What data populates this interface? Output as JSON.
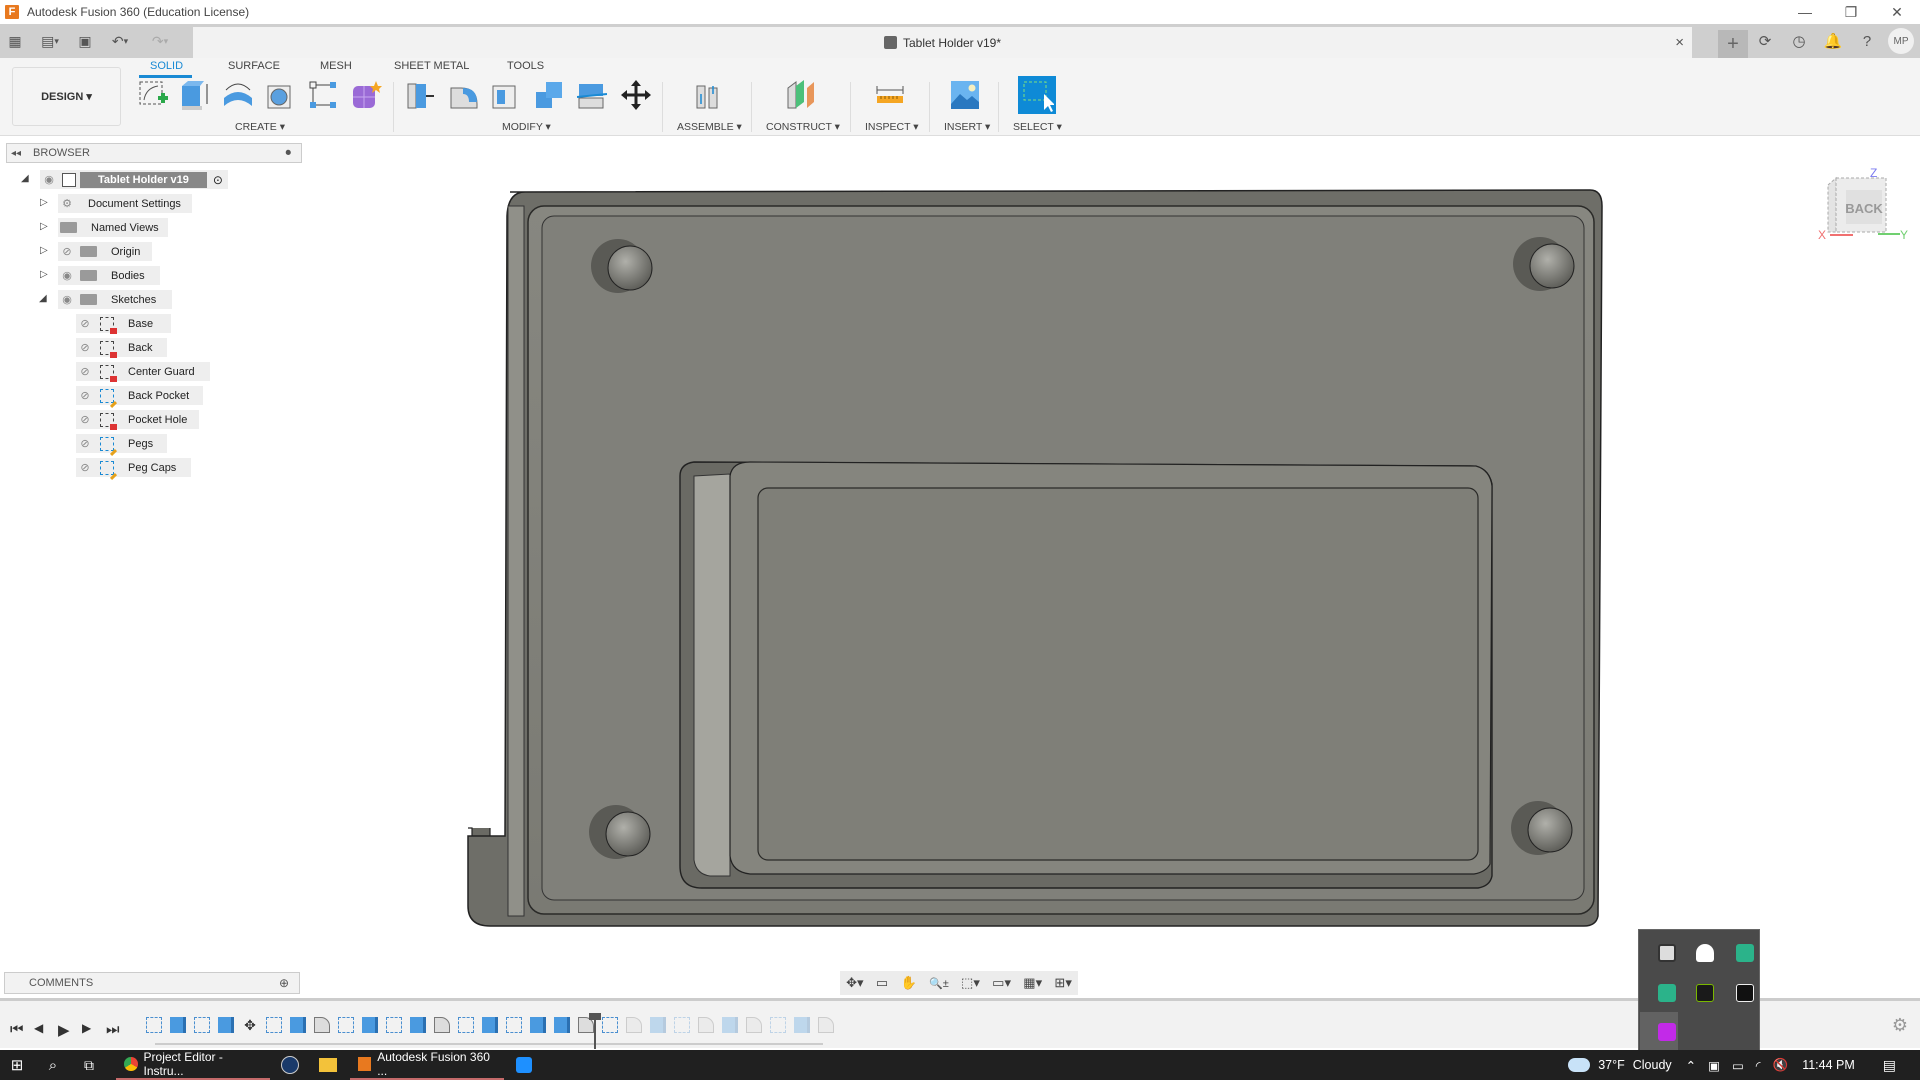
{
  "window": {
    "title": "Autodesk Fusion 360 (Education License)",
    "minimize": "—",
    "restore": "❐",
    "close": "✕"
  },
  "qat": {
    "grid_icon": "▦",
    "file_icon": "▤",
    "save_icon": "💾",
    "undo_icon": "↶",
    "redo_icon": "↷",
    "dropdown": "▾"
  },
  "doc_tab": {
    "title": "Tablet Holder v19*",
    "close": "×"
  },
  "tabbar_right": {
    "new_tab": "+",
    "extensions_icon": "⟳",
    "job_status_icon": "◷",
    "notifications_icon": "🔔",
    "help_icon": "?",
    "user_initials": "MP"
  },
  "ribbon": {
    "workspace": "DESIGN ▾",
    "tabs": [
      "SOLID",
      "SURFACE",
      "MESH",
      "SHEET METAL",
      "TOOLS"
    ],
    "active_tab": "SOLID",
    "groups": [
      "CREATE ▾",
      "MODIFY ▾",
      "ASSEMBLE ▾",
      "CONSTRUCT ▾",
      "INSPECT ▾",
      "INSERT ▾",
      "SELECT ▾"
    ],
    "colors": {
      "accent": "#1a8ad4",
      "tool_blue": "#4a9ae0",
      "select_bg": "#0e8ad6"
    }
  },
  "browser": {
    "title": "BROWSER",
    "collapse_icon": "◂◂",
    "root": "Tablet Holder v19",
    "items": [
      {
        "label": "Document Settings",
        "icon": "gear"
      },
      {
        "label": "Named Views",
        "icon": "folder"
      },
      {
        "label": "Origin",
        "icon": "folder",
        "visible": false
      },
      {
        "label": "Bodies",
        "icon": "folder",
        "visible": true
      },
      {
        "label": "Sketches",
        "icon": "folder",
        "visible": true,
        "expanded": true
      }
    ],
    "sketches": [
      {
        "label": "Base",
        "state": "locked"
      },
      {
        "label": "Back",
        "state": "locked"
      },
      {
        "label": "Center Guard",
        "state": "locked"
      },
      {
        "label": "Back Pocket",
        "state": "editable"
      },
      {
        "label": "Pocket Hole",
        "state": "locked"
      },
      {
        "label": "Pegs",
        "state": "editable"
      },
      {
        "label": "Peg Caps",
        "state": "editable"
      }
    ]
  },
  "viewcube": {
    "face": "BACK",
    "x_label": "X",
    "y_label": "Y",
    "z_label": "Z"
  },
  "comments": {
    "title": "COMMENTS",
    "add_icon": "⊕"
  },
  "navbar": {
    "orbit": "✥▾",
    "look_at": "▭",
    "pan": "✋",
    "zoom": "🔍±",
    "fit": "⬚▾",
    "display": "▭▾",
    "grid": "▦▾",
    "viewports": "⊞▾"
  },
  "timeline": {
    "first": "⏮",
    "prev": "◀",
    "play": "▶",
    "next": "▶",
    "last": "⏭",
    "settings": "⚙"
  },
  "taskbar": {
    "apps": [
      {
        "label": "Project Editor - Instru...",
        "icon": "chrome"
      },
      {
        "label": "Autodesk Fusion 360 ...",
        "icon": "fusion"
      }
    ],
    "weather": {
      "temp": "37°F",
      "condition": "Cloudy"
    },
    "time": "11:44 PM"
  }
}
